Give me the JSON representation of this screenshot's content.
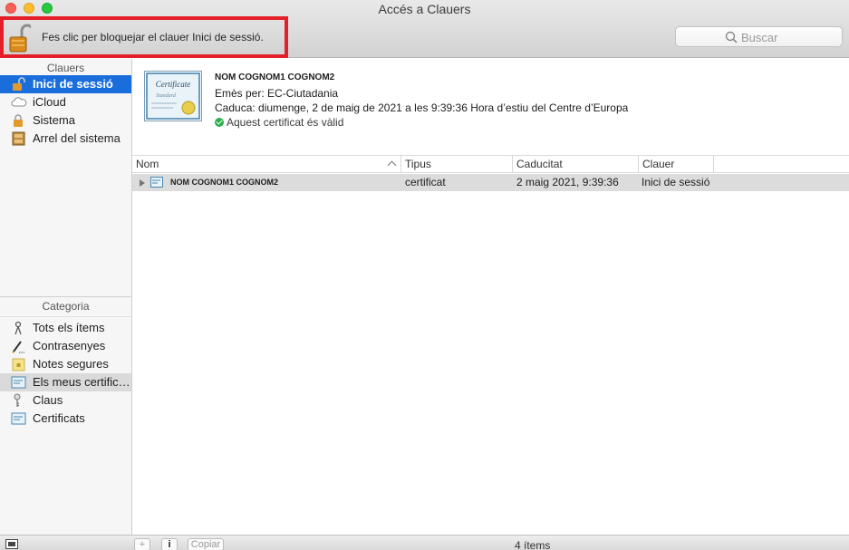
{
  "window": {
    "title": "Accés a Clauers"
  },
  "toolbar": {
    "lock_message": "Fes clic per bloquejar el clauer Inici de sessió.",
    "search_placeholder": "Buscar"
  },
  "sidebar": {
    "keychains_header": "Clauers",
    "keychains": [
      {
        "label": "Inici de sessió",
        "icon": "lock-open-icon",
        "selected": true
      },
      {
        "label": "iCloud",
        "icon": "cloud-icon"
      },
      {
        "label": "Sistema",
        "icon": "lock-icon"
      },
      {
        "label": "Arrel del sistema",
        "icon": "cabinet-icon"
      }
    ],
    "category_header": "Categoria",
    "categories": [
      {
        "label": "Tots els ítems",
        "icon": "all-items-icon"
      },
      {
        "label": "Contrasenyes",
        "icon": "pencil-icon"
      },
      {
        "label": "Notes segures",
        "icon": "secure-note-icon"
      },
      {
        "label": "Els meus certific…",
        "icon": "my-certificate-icon",
        "selected": true
      },
      {
        "label": "Claus",
        "icon": "key-icon"
      },
      {
        "label": "Certificats",
        "icon": "certificate-icon"
      }
    ]
  },
  "certificate": {
    "name": "NOM COGNOM1 COGNOM2",
    "issuer": "Emès per: EC-Ciutadania",
    "expiry": "Caduca: diumenge, 2 de maig de 2021 a les 9:39:36 Hora d’estiu del Centre d’Europa",
    "status": "Aquest certificat és vàlid",
    "image_text": "Certificate",
    "image_subtext": "Standard"
  },
  "table": {
    "columns": [
      "Nom",
      "Tipus",
      "Caducitat",
      "Clauer"
    ],
    "rows": [
      {
        "name": "NOM COGNOM1 COGNOM2",
        "type": "certificat",
        "expires": "2 maig 2021, 9:39:36",
        "keychain": "Inici de sessió"
      }
    ]
  },
  "bottom": {
    "add_label": "+",
    "info_label": "i",
    "copy_label": "Copiar",
    "item_count": "4 ítems"
  },
  "colors": {
    "selection": "#1a6edb",
    "highlight_border": "#e3202a",
    "valid": "#2fae4e"
  }
}
